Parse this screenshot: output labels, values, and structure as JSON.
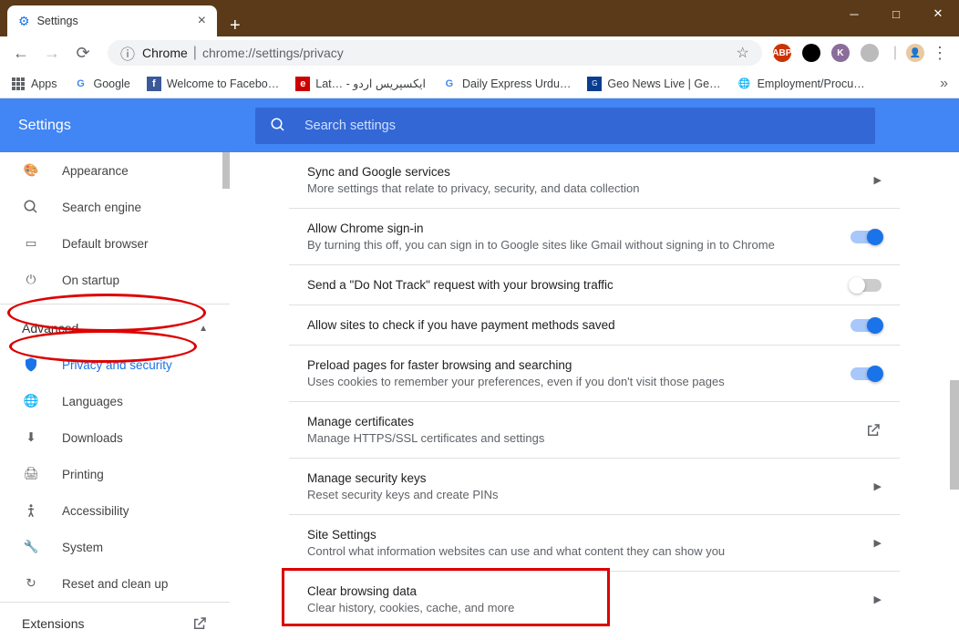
{
  "browser": {
    "tab_title": "Settings",
    "url_prefix": "Chrome",
    "url_path": "chrome://settings/privacy",
    "bookmarks": [
      {
        "label": "Apps",
        "icon": "apps"
      },
      {
        "label": "Google",
        "icon": "g"
      },
      {
        "label": "Welcome to Facebo…",
        "icon": "fb"
      },
      {
        "label": "Lat… - ایکسپریس اردو",
        "icon": "ex"
      },
      {
        "label": "Daily Express Urdu…",
        "icon": "g"
      },
      {
        "label": "Geo News Live | Ge…",
        "icon": "geo"
      },
      {
        "label": "Employment/Procu…",
        "icon": "globe"
      }
    ],
    "ext_icons": [
      {
        "bg": "#c30",
        "fg": "#fff",
        "txt": "ABP"
      },
      {
        "bg": "#000",
        "fg": "#fff",
        "txt": "●"
      },
      {
        "bg": "#8a6",
        "fg": "#fff",
        "txt": "K"
      },
      {
        "bg": "#aaa",
        "fg": "#fff",
        "txt": "○"
      }
    ]
  },
  "header": {
    "title": "Settings",
    "search_placeholder": "Search settings"
  },
  "sidebar": {
    "top_items": [
      {
        "icon": "🎨",
        "label": "Appearance"
      },
      {
        "icon": "🔍",
        "label": "Search engine"
      },
      {
        "icon": "▭",
        "label": "Default browser"
      },
      {
        "icon": "⏻",
        "label": "On startup"
      }
    ],
    "advanced_label": "Advanced",
    "adv_items": [
      {
        "icon": "🛡",
        "label": "Privacy and security",
        "active": true
      },
      {
        "icon": "🌐",
        "label": "Languages"
      },
      {
        "icon": "⬇",
        "label": "Downloads"
      },
      {
        "icon": "🖨",
        "label": "Printing"
      },
      {
        "icon": "♿",
        "label": "Accessibility"
      },
      {
        "icon": "🔧",
        "label": "System"
      },
      {
        "icon": "↻",
        "label": "Reset and clean up"
      }
    ],
    "extensions_label": "Extensions"
  },
  "content": {
    "rows": [
      {
        "title": "Sync and Google services",
        "sub": "More settings that relate to privacy, security, and data collection",
        "right": "arrow"
      },
      {
        "title": "Allow Chrome sign-in",
        "sub": "By turning this off, you can sign in to Google sites like Gmail without signing in to Chrome",
        "right": "toggle-on"
      },
      {
        "title": "Send a \"Do Not Track\" request with your browsing traffic",
        "sub": "",
        "right": "toggle-off"
      },
      {
        "title": "Allow sites to check if you have payment methods saved",
        "sub": "",
        "right": "toggle-on"
      },
      {
        "title": "Preload pages for faster browsing and searching",
        "sub": "Uses cookies to remember your preferences, even if you don't visit those pages",
        "right": "toggle-on"
      },
      {
        "title": "Manage certificates",
        "sub": "Manage HTTPS/SSL certificates and settings",
        "right": "launch"
      },
      {
        "title": "Manage security keys",
        "sub": "Reset security keys and create PINs",
        "right": "arrow"
      },
      {
        "title": "Site Settings",
        "sub": "Control what information websites can use and what content they can show you",
        "right": "arrow"
      },
      {
        "title": "Clear browsing data",
        "sub": "Clear history, cookies, cache, and more",
        "right": "arrow"
      }
    ]
  }
}
